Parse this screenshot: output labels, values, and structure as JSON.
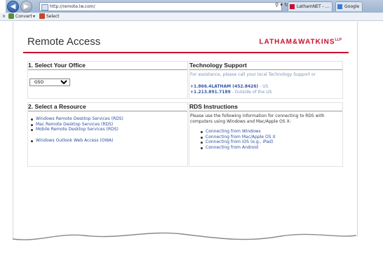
{
  "browser": {
    "url": "http://remote.lw.com/",
    "search_icon": "search-icon",
    "tabs": [
      {
        "label": "LathamNET - ...",
        "icon": "latham-icon",
        "color": "#c8102e"
      },
      {
        "label": "Google",
        "icon": "google-icon",
        "color": "#3b7bd6"
      }
    ]
  },
  "commandbar": {
    "close": "×",
    "convert_label": "Convert",
    "select_label": "Select"
  },
  "page": {
    "title": "Remote Access",
    "brand": "LATHAM&WATKINS",
    "brand_suffix": "LLP",
    "brand_color": "#c8102e"
  },
  "office": {
    "heading": "1. Select Your Office",
    "selected": "GSO",
    "options": [
      "GSO"
    ]
  },
  "support": {
    "heading": "Technology Support",
    "intro": "For assistance, please call your local Technology Support or",
    "phone_us": "+1.866.4LATHAM (452.8426)",
    "phone_us_suffix": "- US",
    "phone_outside": "+1.213.891.7189",
    "phone_outside_suffix": "- Outside of the US"
  },
  "resource": {
    "heading": "2. Select a Resource",
    "items": [
      "Windows Remote Desktop Services (RDS)",
      "Mac Remote Desktop Services (RDS)",
      "Mobile Remote Desktop Services (RDS)"
    ],
    "owa": "Windows Outlook Web Access (OWA)"
  },
  "rds": {
    "heading": "RDS Instructions",
    "intro": "Please use the following information for connecting to RDS with computers using Windows and Mac/Apple OS X:",
    "links": [
      "Connecting from Windows",
      "Connecting from Mac/Apple OS X",
      "Connecting from iOS (e.g., iPad)",
      "Connecting from Android"
    ]
  }
}
